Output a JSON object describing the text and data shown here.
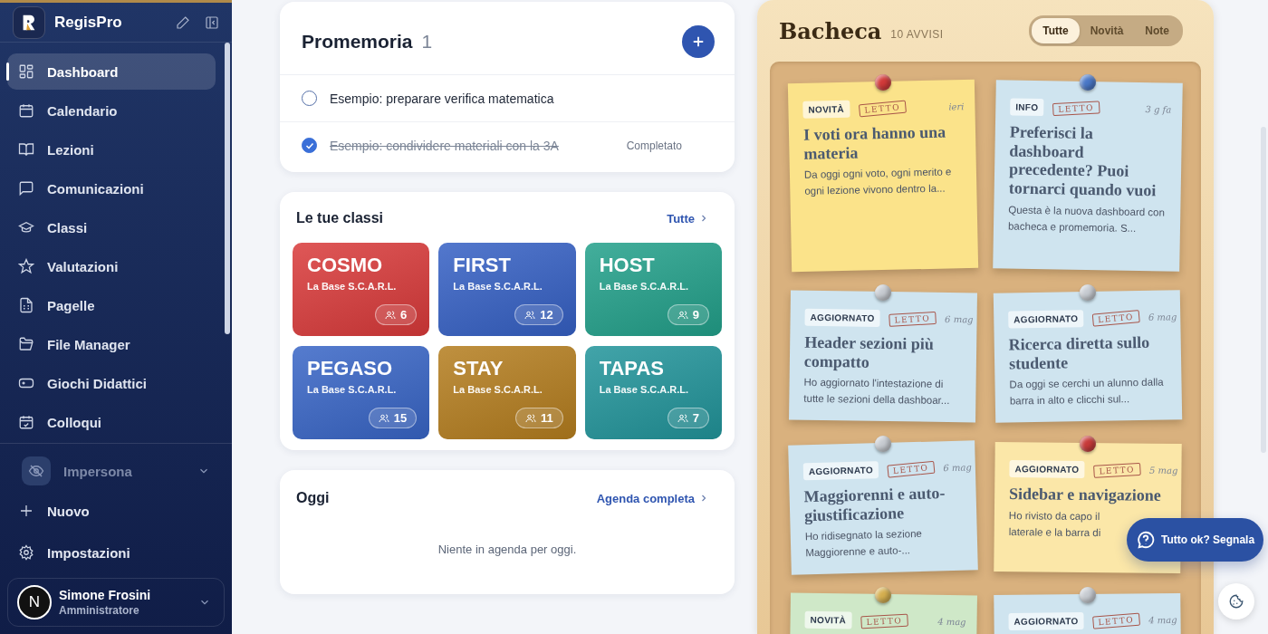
{
  "sidebar": {
    "brand": "RegisPro",
    "items": [
      {
        "label": "Dashboard",
        "selected": true
      },
      {
        "label": "Calendario",
        "selected": false
      },
      {
        "label": "Lezioni",
        "selected": false
      },
      {
        "label": "Comunicazioni",
        "selected": false
      },
      {
        "label": "Classi",
        "selected": false
      },
      {
        "label": "Valutazioni",
        "selected": false
      },
      {
        "label": "Pagelle",
        "selected": false
      },
      {
        "label": "File Manager",
        "selected": false
      },
      {
        "label": "Giochi Didattici",
        "selected": false
      },
      {
        "label": "Colloqui",
        "selected": false
      }
    ],
    "impersona": {
      "label": "Impersona",
      "disabled": true
    },
    "new_label": "Nuovo",
    "settings_label": "Impostazioni",
    "user": {
      "initial": "N",
      "name": "Simone Frosini",
      "role": "Amministratore"
    }
  },
  "reminders": {
    "title": "Promemoria",
    "count": "1",
    "items": [
      {
        "text": "Esempio: preparare verifica matematica",
        "checked": false
      },
      {
        "text": "Esempio: condividere materiali con la 3A",
        "checked": true,
        "status": "Completato"
      }
    ]
  },
  "classes": {
    "title": "Le tue classi",
    "link": "Tutte",
    "items": [
      {
        "name": "COSMO",
        "org": "La Base S.C.A.R.L.",
        "count": "6",
        "color": "#d93a3a"
      },
      {
        "name": "FIRST",
        "org": "La Base S.C.A.R.L.",
        "count": "12",
        "color": "#3560c4"
      },
      {
        "name": "HOST",
        "org": "La Base S.C.A.R.L.",
        "count": "9",
        "color": "#22a08a"
      },
      {
        "name": "PEGASO",
        "org": "La Base S.C.A.R.L.",
        "count": "15",
        "color": "#3865c6"
      },
      {
        "name": "STAY",
        "org": "La Base S.C.A.R.L.",
        "count": "11",
        "color": "#b47d1e"
      },
      {
        "name": "TAPAS",
        "org": "La Base S.C.A.R.L.",
        "count": "7",
        "color": "#21949a"
      }
    ]
  },
  "today": {
    "title": "Oggi",
    "link": "Agenda completa",
    "empty": "Niente in agenda per oggi."
  },
  "board": {
    "title": "Bacheca",
    "count": "10 AVVISI",
    "filters": [
      {
        "label": "Tutte",
        "selected": true
      },
      {
        "label": "Novità",
        "selected": false
      },
      {
        "label": "Note",
        "selected": false
      }
    ],
    "notes": [
      {
        "tag": "NOVITÀ",
        "stamp": "LETTO",
        "date": "ieri",
        "title": "I voti ora hanno una materia",
        "text": "Da oggi ogni voto, ogni merito e ogni lezione vivono dentro la...",
        "color": "#fbe38a",
        "pin": {
          "color": "#d23a3a"
        }
      },
      {
        "tag": "INFO",
        "stamp": "LETTO",
        "date": "3 g fa",
        "title": "Preferisci la dashboard precedente? Puoi tornarci quando vuoi",
        "text": "Questa è la nuova dashboard con bacheca e promemoria. S...",
        "color": "#cfe4ef",
        "pin": {
          "color": "#4a78c8"
        }
      },
      {
        "tag": "AGGIORNATO",
        "stamp": "LETTO",
        "date": "6 mag",
        "title": "Header sezioni più compatto",
        "text": "Ho aggiornato l'intestazione di tutte le sezioni della dashboar...",
        "color": "#cfe4ef",
        "pin": {
          "color": "#c8ccd2"
        }
      },
      {
        "tag": "AGGIORNATO",
        "stamp": "LETTO",
        "date": "6 mag",
        "title": "Ricerca diretta sullo studente",
        "text": "Da oggi se cerchi un alunno dalla barra in alto e clicchi sul...",
        "color": "#cfe4ef",
        "pin": {
          "color": "#c8ccd2"
        }
      },
      {
        "tag": "AGGIORNATO",
        "stamp": "LETTO",
        "date": "6 mag",
        "title": "Maggiorenni e auto-giustificazione",
        "text": "Ho ridisegnato la sezione Maggiorenne e auto-...",
        "color": "#cfe4ef",
        "pin": {
          "color": "#c8ccd2"
        }
      },
      {
        "tag": "AGGIORNATO",
        "stamp": "LETTO",
        "date": "5 mag",
        "title": "Sidebar e navigazione",
        "text": "Ho rivisto da capo il\nlaterale e la barra di",
        "color": "#fbe7a8",
        "pin": {
          "color": "#c83a3a"
        }
      },
      {
        "tag": "NOVITÀ",
        "stamp": "LETTO",
        "date": "4 mag",
        "color": "#cfe8c8",
        "pin": {
          "color": "#d6b050"
        }
      },
      {
        "tag": "AGGIORNATO",
        "stamp": "LETTO",
        "date": "4 mag",
        "color": "#cfe4ef",
        "pin": {
          "color": "#c8ccd2"
        }
      }
    ]
  },
  "feedback_button": "Tutto ok? Segnala"
}
